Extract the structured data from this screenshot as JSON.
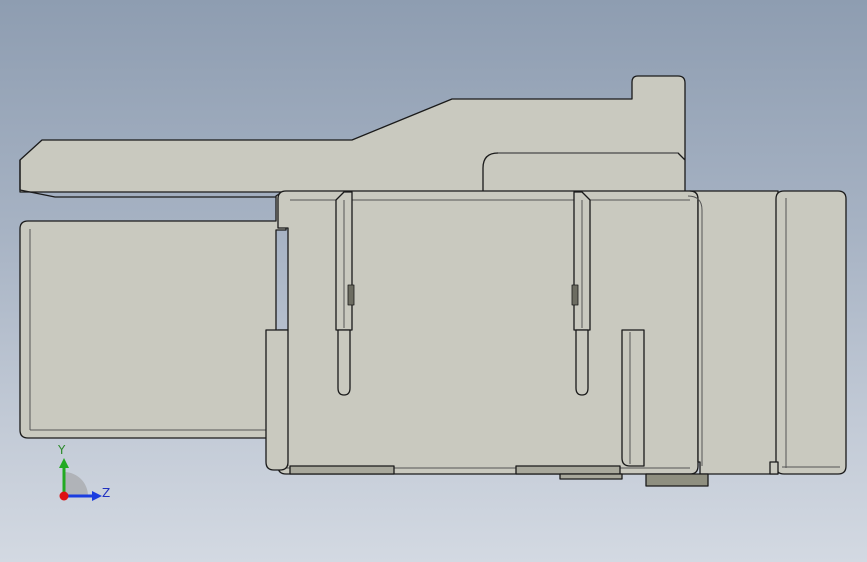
{
  "triad": {
    "y_label": "Y",
    "z_label": "Z",
    "y_color": "#22aa22",
    "z_color": "#1a3de0",
    "x_color": "#dd1111"
  },
  "colors": {
    "body_fill": "#c9c9bf",
    "body_shade": "#a8a89c",
    "edge": "#1a1a1a",
    "dark_tab": "#8f8f80",
    "background_top": "#8e9db1",
    "background_bottom": "#d3d9e2"
  }
}
